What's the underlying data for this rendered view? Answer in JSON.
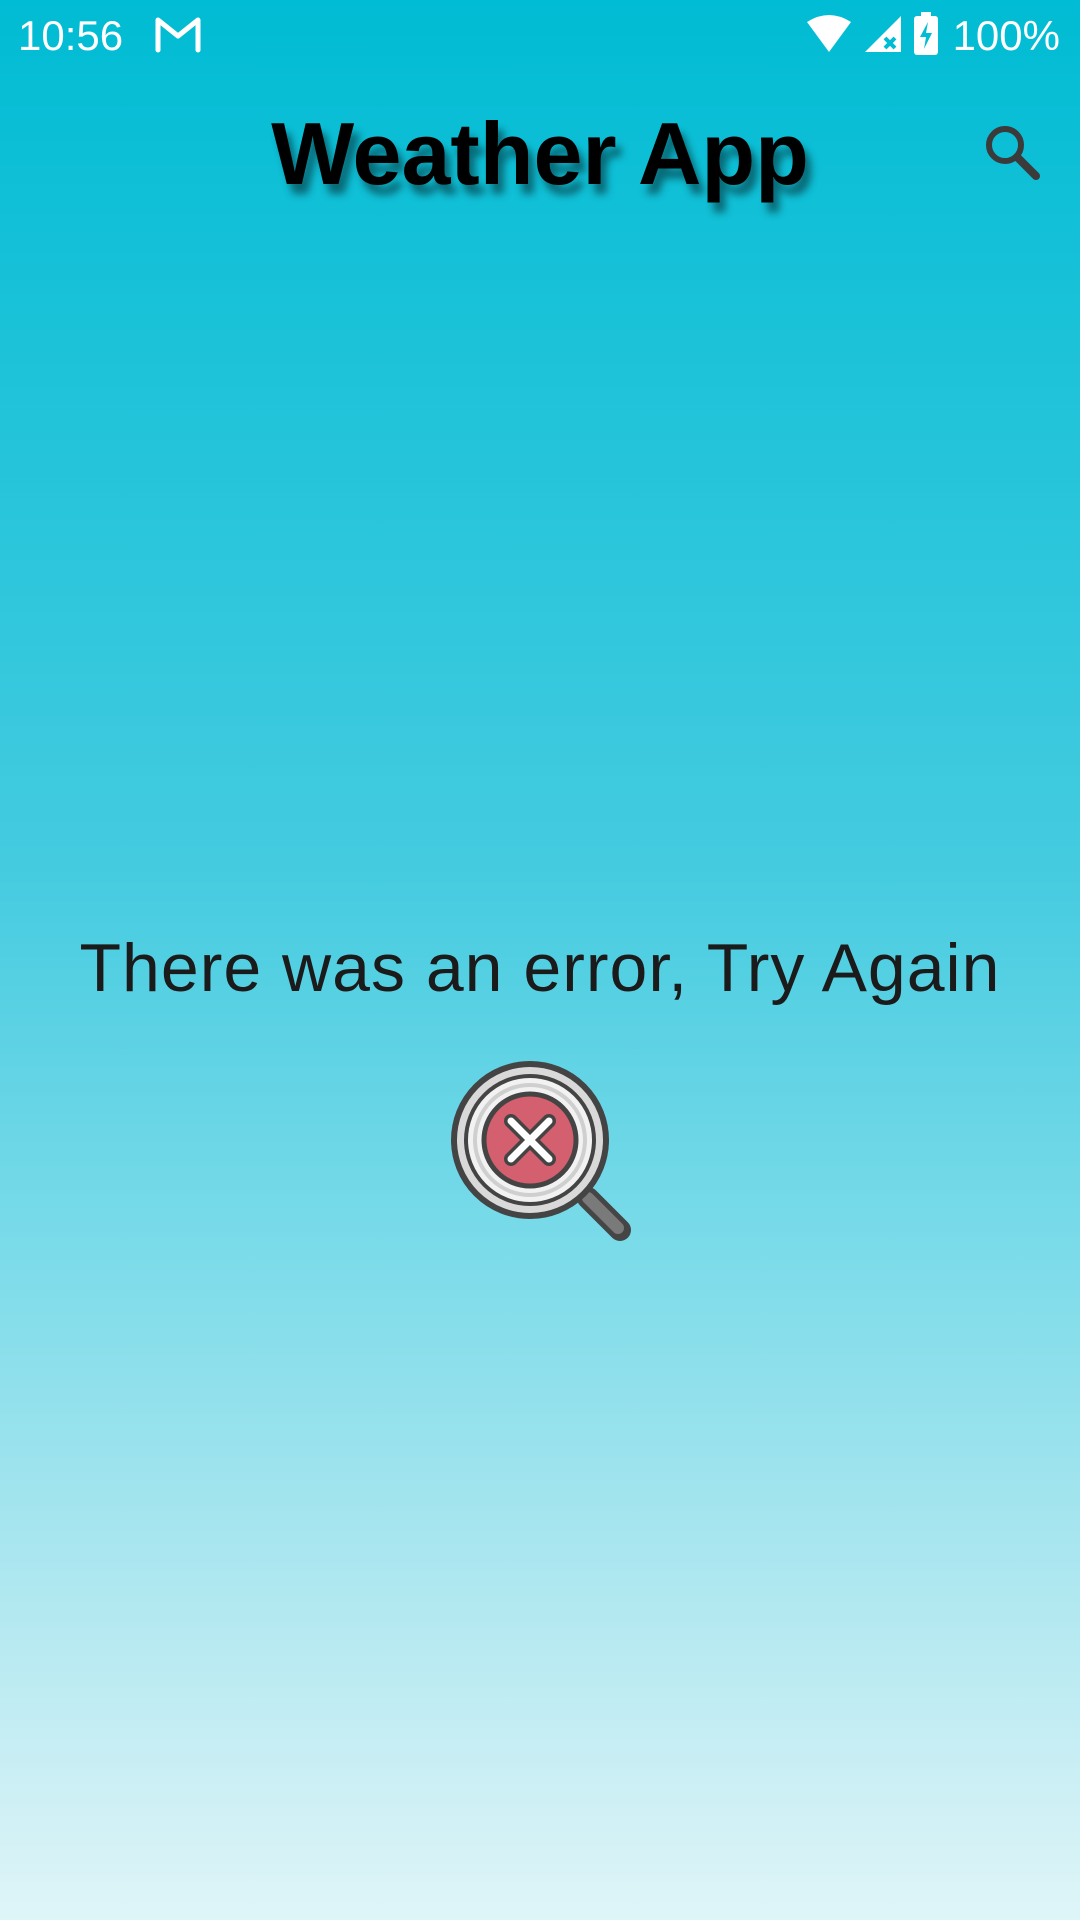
{
  "status_bar": {
    "time": "10:56",
    "battery_percent": "100%",
    "icons": [
      "gmail-icon",
      "wifi-icon",
      "cell-signal-icon",
      "battery-charging-icon"
    ]
  },
  "app_bar": {
    "title": "Weather App",
    "search_icon": "search-icon"
  },
  "content": {
    "error_message": "There was an error, Try Again",
    "error_icon": "search-error-icon"
  },
  "colors": {
    "gradient_top": "#00bcd4",
    "gradient_bottom": "#dff5f8",
    "error_icon_red": "#d45f6e",
    "text_dark": "#1b1b1b"
  }
}
